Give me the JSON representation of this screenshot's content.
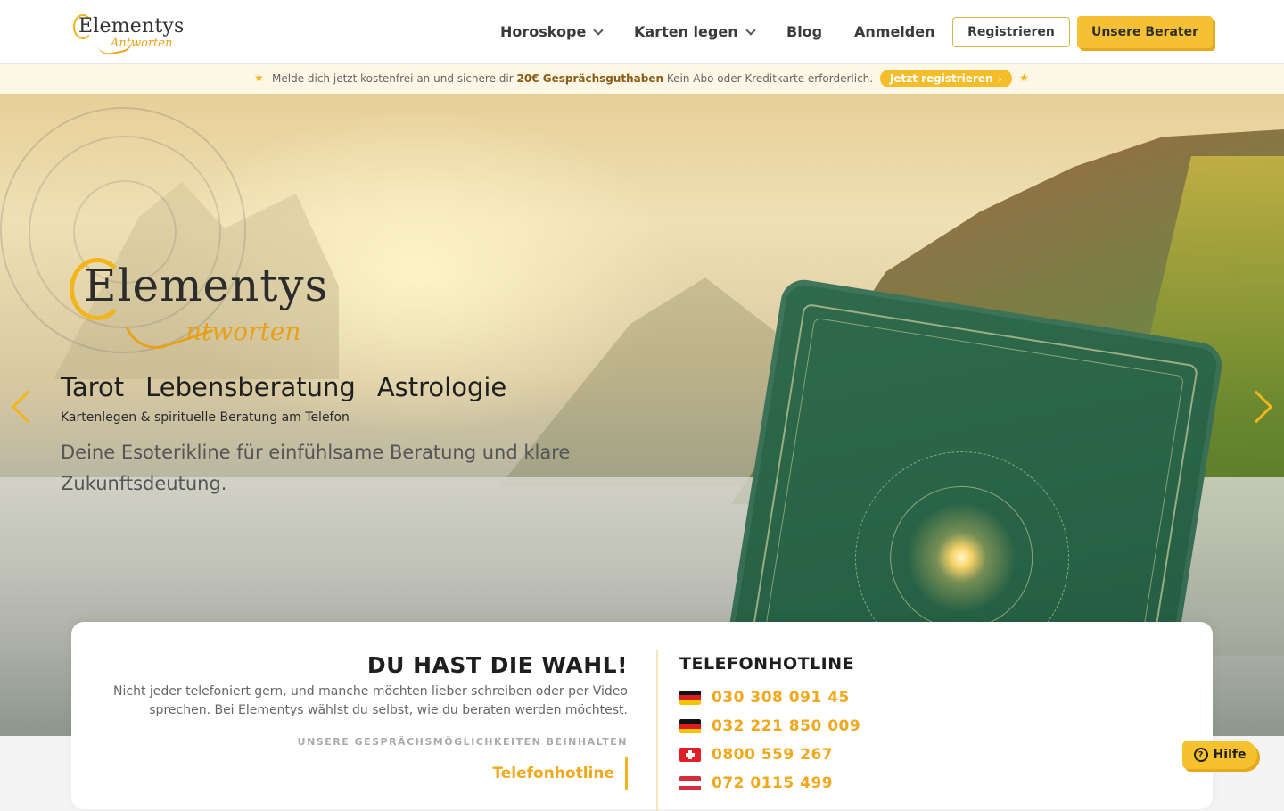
{
  "header": {
    "logo_main": "Elementys",
    "logo_sub": "Antworten",
    "nav": [
      {
        "label": "Horoskope",
        "has_dropdown": true
      },
      {
        "label": "Karten legen",
        "has_dropdown": true
      },
      {
        "label": "Blog",
        "has_dropdown": false
      },
      {
        "label": "Anmelden",
        "has_dropdown": false
      }
    ],
    "register_label": "Registrieren",
    "advisors_label": "Unsere Berater"
  },
  "promo": {
    "text_before": "Melde dich jetzt kostenfrei an und sichere dir",
    "highlight": "20€ Gesprächsguthaben",
    "text_after": "Kein Abo oder Kreditkarte erforderlich.",
    "cta_label": "Jetzt registrieren",
    "cta_arrow": "›",
    "star": "★"
  },
  "hero": {
    "logo_main": "Elementys",
    "logo_sub": "ntworten",
    "services": [
      "Tarot",
      "Lebensberatung",
      "Astrologie"
    ],
    "subtitle": "Kartenlegen & spirituelle Beratung am Telefon",
    "description": "Deine Esoterikline für einfühlsame Beratung und klare Zukunftsdeutung."
  },
  "choice": {
    "title": "DU HAST DIE WAHL!",
    "text": "Nicht jeder telefoniert gern, und manche möchten lieber schreiben oder per Video sprechen. Bei Elementys wählst du selbst, wie du beraten werden möchtest.",
    "caption": "UNSERE GESPRÄCHSMÖGLICHKEITEN BEINHALTEN",
    "option": "Telefonhotline"
  },
  "hotline": {
    "title": "TELEFONHOTLINE",
    "numbers": [
      {
        "country": "de",
        "number": "030 308 091 45"
      },
      {
        "country": "de",
        "number": "032 221 850 009"
      },
      {
        "country": "ch",
        "number": "0800 559 267"
      },
      {
        "country": "at",
        "number": "072 0115 499"
      }
    ]
  },
  "help": {
    "label": "Hilfe",
    "icon": "?"
  },
  "colors": {
    "accent": "#f5c033",
    "accent_text": "#f0a81c",
    "brand_dark": "#2c2c2c"
  }
}
